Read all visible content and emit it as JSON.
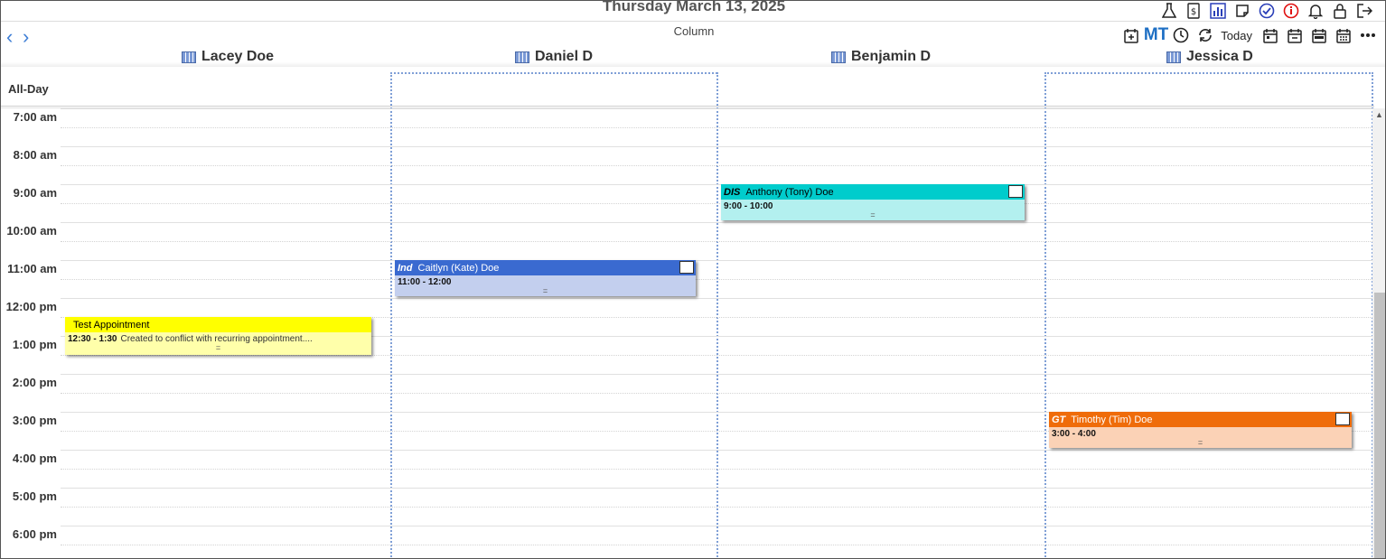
{
  "header": {
    "date_title": "Thursday March 13, 2025",
    "view_mode": "Column",
    "prev_icon": "chevron-left-icon",
    "next_icon": "chevron-right-icon"
  },
  "toolbar": {
    "top_icons": [
      "flask-icon",
      "receipt-icon",
      "bar-chart-icon",
      "note-icon",
      "check-circle-icon",
      "info-icon",
      "bell-icon",
      "lock-icon",
      "logout-icon"
    ],
    "mt_label": "MT",
    "today_label": "Today",
    "tool_icons": [
      "calendar-add-icon",
      "clock-icon",
      "refresh-icon",
      "calendar-day-icon",
      "calendar-minus-icon",
      "calendar-week-icon",
      "calendar-month-icon",
      "more-icon"
    ]
  },
  "providers": [
    {
      "name": "Lacey Doe"
    },
    {
      "name": "Daniel D"
    },
    {
      "name": "Benjamin D"
    },
    {
      "name": "Jessica D"
    }
  ],
  "all_day_label": "All-Day",
  "hours": [
    "7:00 am",
    "8:00 am",
    "9:00 am",
    "10:00 am",
    "11:00 am",
    "12:00 pm",
    "1:00 pm",
    "2:00 pm",
    "3:00 pm",
    "4:00 pm",
    "5:00 pm",
    "6:00 pm"
  ],
  "appointments": [
    {
      "type": "",
      "title": "Test Appointment",
      "time": "12:30 - 1:30",
      "description": "Created to conflict with recurring appointment....",
      "grip": "=",
      "head_color": "#ffff00",
      "body_color": "#ffffaa",
      "head_text_color": "#000000"
    },
    {
      "type": "Ind",
      "title": "Caitlyn (Kate) Doe",
      "time": "11:00 - 12:00",
      "description": "",
      "grip": "=",
      "head_color": "#3a6ad0",
      "body_color": "#c3cfee",
      "head_text_color": "#ffffff"
    },
    {
      "type": "DIS",
      "title": "Anthony (Tony) Doe",
      "time": "9:00 - 10:00",
      "description": "",
      "grip": "=",
      "head_color": "#00cccc",
      "body_color": "#b3f0ef",
      "head_text_color": "#000000"
    },
    {
      "type": "GT",
      "title": "Timothy (Tim) Doe",
      "time": "3:00 - 4:00",
      "description": "",
      "grip": "=",
      "head_color": "#ef6c0a",
      "body_color": "#fbd2b6",
      "head_text_color": "#ffffff"
    }
  ],
  "colors": {
    "accent": "#3f7fd6",
    "column_border": "#7f9fd6"
  }
}
